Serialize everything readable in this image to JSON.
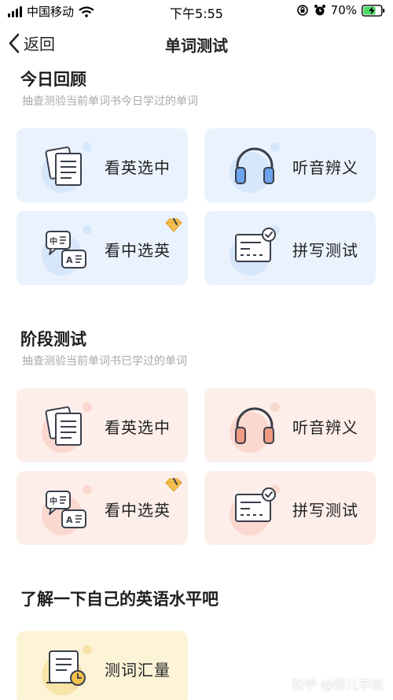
{
  "status_bar": {
    "carrier": "中国移动",
    "time": "下午5:55",
    "battery": "70%",
    "battery_level": 0.7,
    "signal_icon": "signal-bars-icon",
    "wifi_icon": "wifi-icon"
  },
  "nav": {
    "back_label": "返回",
    "title": "单词测试"
  },
  "sections": [
    {
      "title": "今日回顾",
      "subtitle": "抽查测验当前单词书今日学过的单词",
      "cards": [
        {
          "label": "看英选中",
          "icon": "document-icon"
        },
        {
          "label": "听音辨义",
          "icon": "headphones-icon"
        },
        {
          "label": "看中选英",
          "icon": "chat-bubbles-icon",
          "badge": "gem-icon"
        },
        {
          "label": "拼写测试",
          "icon": "spelling-card-icon"
        }
      ]
    },
    {
      "title": "阶段测试",
      "subtitle": "抽查测验当前单词书已学过的单词",
      "cards": [
        {
          "label": "看英选中",
          "icon": "document-icon"
        },
        {
          "label": "听音辨义",
          "icon": "headphones-icon"
        },
        {
          "label": "看中选英",
          "icon": "chat-bubbles-icon",
          "badge": "gem-icon"
        },
        {
          "label": "拼写测试",
          "icon": "spelling-card-icon"
        }
      ]
    },
    {
      "title": "了解一下自己的英语水平吧",
      "cards": [
        {
          "label": "测词汇量",
          "icon": "scroll-clock-icon"
        }
      ]
    }
  ],
  "watermark": "知乎 @郡儿学姐",
  "colors": {
    "blue_card": "#eaf2fd",
    "blue_accent": "#6da3ec",
    "pink_card": "#fdeeea",
    "pink_accent": "#ef9a82",
    "yellow_card": "#fdf4d8",
    "yellow_accent": "#f2c14a",
    "outline": "#3a3f4b",
    "gem": "#f3c04f"
  }
}
